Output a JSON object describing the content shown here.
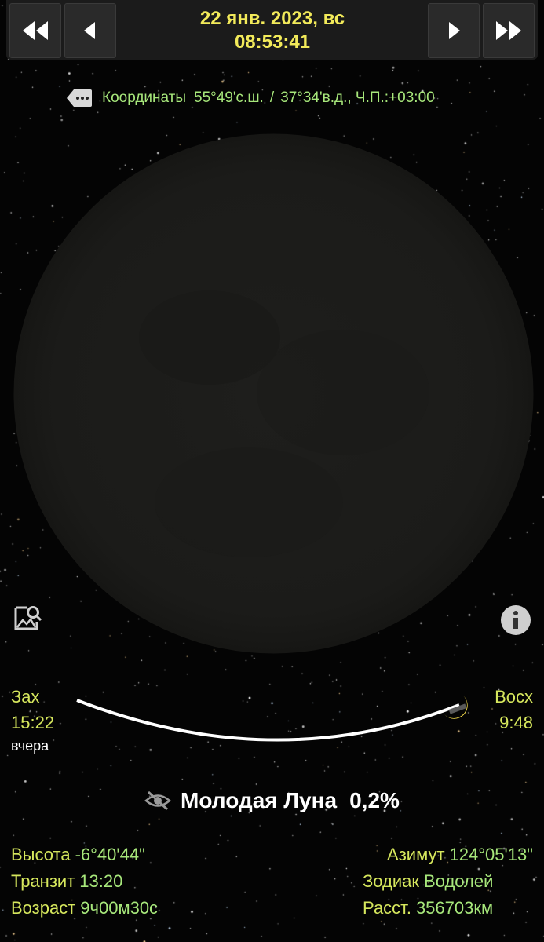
{
  "header": {
    "date": "22 янв. 2023,  вс",
    "time": "08:53:41",
    "buttons": {
      "fast_back": "fast-backward",
      "back": "step-backward",
      "forward": "step-forward",
      "fast_forward": "fast-forward"
    }
  },
  "coordinates": {
    "label": "Координаты",
    "lat": "55°49'с.ш.",
    "separator": "/",
    "lon": "37°34'в.д., Ч.П.:+03:00"
  },
  "moon_path": {
    "set_label": "Зах",
    "set_time": "15:22",
    "set_day": "вчера",
    "rise_label": "Восх",
    "rise_time": "9:48"
  },
  "phase": {
    "name": "Молодая Луна",
    "illumination": "0,2%",
    "illumination_fraction": 0.002
  },
  "details": {
    "altitude_label": "Высота",
    "altitude": "-6°40'44\"",
    "transit_label": "Транзит",
    "transit": "13:20",
    "age_label": "Возраст",
    "age": "9ч00м30с",
    "azimuth_label": "Азимут",
    "azimuth": "124°05'13\"",
    "zodiac_label": "Зодиак",
    "zodiac": "Водолей",
    "distance_label": "Расст.",
    "distance": "356703км"
  },
  "colors": {
    "date": "#f2ea5a",
    "label": "#d6e75d",
    "value": "#a7e77b",
    "moon": "#1d1d1b",
    "background": "#040404"
  }
}
